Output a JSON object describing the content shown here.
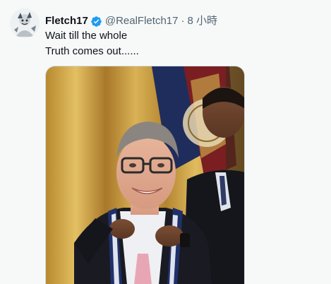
{
  "tweet": {
    "author_name": "Fletch17",
    "handle": "@RealFletch17",
    "separator": "·",
    "time": "8 小時",
    "text_lines": [
      "Wait till the whole",
      "Truth comes out......"
    ],
    "verified": true
  },
  "icons": {
    "avatar": "avatar-image",
    "verified": "verified-badge-icon"
  },
  "media": {
    "description_type": "photo"
  },
  "colors": {
    "background": "#f7f9f9",
    "text_primary": "#0f1419",
    "text_secondary": "#536471",
    "verified_blue": "#1d9bf0"
  }
}
